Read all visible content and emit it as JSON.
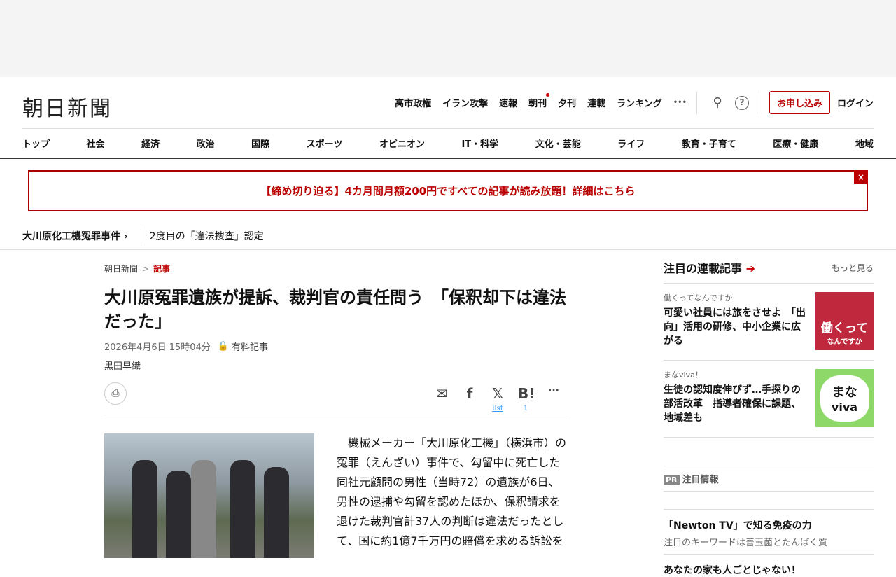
{
  "logo": "朝日新聞",
  "topnav": [
    "高市政権",
    "イラン攻撃",
    "速報",
    "朝刊",
    "夕刊",
    "連載",
    "ランキング"
  ],
  "more_label": "•••",
  "apply_label": "お申し込み",
  "login_label": "ログイン",
  "categories": [
    "トップ",
    "社会",
    "経済",
    "政治",
    "国際",
    "スポーツ",
    "オピニオン",
    "IT・科学",
    "文化・芸能",
    "ライフ",
    "教育・子育て",
    "医療・健康",
    "地域"
  ],
  "banner": {
    "text": "【締め切り迫る】4カ月間月額200円ですべての記事が読み放題！詳細はこちら",
    "close": "×"
  },
  "topic": {
    "name": "大川原化工機冤罪事件",
    "link": "2度目の「違法捜査」認定"
  },
  "breadcrumb": [
    "朝日新聞",
    "記事"
  ],
  "article": {
    "title": "大川原冤罪遺族が提訴、裁判官の責任問う　「保釈却下は違法だった」",
    "date": "2026年4月6日 15時04分",
    "paid": "有料記事",
    "author": "黒田早織",
    "share_counts": {
      "x": "list",
      "hatena": "1"
    },
    "body_pre": "機械メーカー「大川原化工機」（",
    "body_link": "横浜市",
    "body_post": "）の冤罪（えんざい）事件で、勾留中に死亡した同社元顧問の男性（当時72）の遺族が6日、男性の逮捕や勾留を認めたほか、保釈請求を退けた裁判官計37人の判断は違法だったとして、国に約1億7千万円の賠償を求める訴訟を"
  },
  "sidebar": {
    "title": "注目の連載記事",
    "more": "もっと見る",
    "items": [
      {
        "series": "働くってなんですか",
        "headline": "可愛い社員には旅をさせよ　「出向」活用の研修、中小企業に広がる",
        "thumb1": "働くって",
        "thumb2": "なんですか"
      },
      {
        "series": "まなviva！",
        "headline": "生徒の認知度伸びず…手探りの部活改革　指導者確保に課題、地域差も",
        "thumb1": "まな",
        "thumb2": "viva"
      }
    ],
    "pr_tag": "PR",
    "pr_title": "注目情報",
    "pr_items": [
      {
        "headline": "「Newton TV」で知る免疫の力",
        "sub": "注目のキーワードは善玉菌とたんぱく質"
      },
      {
        "headline": "あなたの家も人ごとじゃない！"
      }
    ]
  }
}
